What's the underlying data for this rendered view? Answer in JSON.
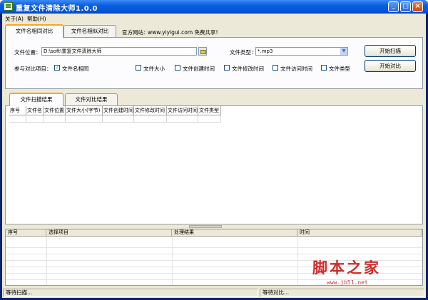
{
  "window": {
    "title": "重复文件清除大师1.0.0",
    "min": "_",
    "max": "□",
    "close": "×"
  },
  "menu": {
    "about": "关于(A)",
    "help": "帮助(H)"
  },
  "top_tabs": [
    {
      "label": "文件名相同对比",
      "active": true
    },
    {
      "label": "文件名相似对比",
      "active": false
    }
  ],
  "site": {
    "label": "官方网站：",
    "text": "www.yiyigui.com 免费共享!"
  },
  "form": {
    "location_label": "文件位置：",
    "location_value": "D:\\soft\\重复文件清除大师",
    "type_label": "文件类型：",
    "type_value": "*.mp3",
    "compare_label": "参与对比项目：",
    "checks": [
      {
        "label": "文件名相同",
        "checked": true
      },
      {
        "label": "文件大小",
        "checked": false
      },
      {
        "label": "文件创建时间",
        "checked": false
      },
      {
        "label": "文件修改时间",
        "checked": false
      },
      {
        "label": "文件访问时间",
        "checked": false
      },
      {
        "label": "文件类型",
        "checked": false
      }
    ],
    "scan_button": "开始扫描",
    "compare_button": "开始对比"
  },
  "mid_tabs": [
    {
      "label": "文件扫描结果",
      "active": true
    },
    {
      "label": "文件对比结果",
      "active": false
    }
  ],
  "scan_grid": {
    "columns": [
      "序号",
      "文件名",
      "文件位置",
      "文件大小(字节)",
      "文件创建时间",
      "文件修改时间",
      "文件访问时间",
      "文件类型"
    ]
  },
  "log_grid": {
    "columns": [
      "序号",
      "选择项目",
      "处理结果",
      "时间"
    ]
  },
  "watermark": {
    "main": "脚本之家",
    "sub": "www.jb51.net"
  },
  "status": {
    "left": "等待扫描...",
    "right": "等待对比..."
  }
}
